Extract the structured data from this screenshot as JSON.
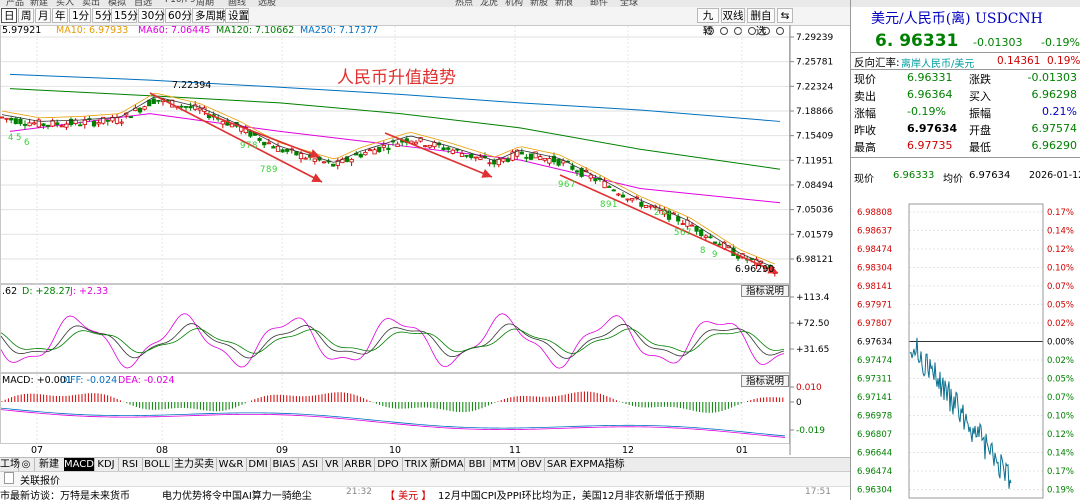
{
  "top_menu": [
    "产品",
    "新建",
    "买入",
    "卖出",
    "模拟",
    "自选",
    "F10/F9",
    "周期",
    "画线",
    "选股",
    "热点",
    "龙虎",
    "机构",
    "新股",
    "新浪",
    "邮件",
    "全球"
  ],
  "toolbar": {
    "periods": [
      "日",
      "周",
      "月",
      "年",
      "1分",
      "5分",
      "15分",
      "30分",
      "60分",
      "多周期",
      "设置"
    ],
    "active_period": "日",
    "right_buttons": [
      "九转",
      "双线",
      "删自选",
      "⇆"
    ]
  },
  "indicators": {
    "ma5": "5.97921",
    "ma10": "MA10: 6.97933",
    "ma60": "MA60: 7.06445",
    "ma120": "MA120: 7.10662",
    "ma250": "MA250: 7.17377",
    "kdj_k": ".62",
    "kdj_d": "D: +28.27",
    "kdj_j": "J: +2.33",
    "macd": "MACD: +0.001",
    "diff": "DIFF: -0.024",
    "dea": "DEA: -0.024"
  },
  "annotations": {
    "title": "人民币升值趋势",
    "high_label": "7.22394",
    "low_label": "6.96290",
    "sub_btn_1": "指标说明",
    "sub_btn_2": "指标说明",
    "td_counts": [
      "4",
      "5",
      "6",
      "7",
      "8",
      "9",
      "9",
      "7",
      "8",
      "9",
      "6",
      "7",
      "8",
      "9",
      "1",
      "2",
      "3",
      "4",
      "5",
      "6",
      "7",
      "8",
      "9"
    ]
  },
  "colors": {
    "ma5": "#000000",
    "ma10": "#e89c00",
    "ma60": "#e000e0",
    "ma120": "#008000",
    "ma250": "#0070c0",
    "up": "#d00000",
    "down": "#008000",
    "arrow": "#e03030",
    "td": "#32d232"
  },
  "chart_data": {
    "type": "line",
    "title": "人民币升值趋势",
    "x": [
      "07",
      "08",
      "09",
      "10",
      "11",
      "12",
      "01"
    ],
    "ylim": [
      6.9629,
      7.29239
    ],
    "y_ticks": [
      "7.29239",
      "7.25781",
      "7.22324",
      "7.18866",
      "7.15409",
      "7.11951",
      "7.08494",
      "7.05036",
      "7.01579",
      "6.98121"
    ],
    "series": [
      {
        "name": "MA60",
        "values": [
          7.16,
          7.185,
          7.16,
          7.14,
          7.12,
          7.08,
          7.06
        ]
      },
      {
        "name": "MA120",
        "values": [
          7.22,
          7.21,
          7.2,
          7.185,
          7.165,
          7.135,
          7.107
        ]
      },
      {
        "name": "MA250",
        "values": [
          7.24,
          7.232,
          7.222,
          7.212,
          7.2,
          7.19,
          7.174
        ]
      }
    ],
    "annotations": [
      {
        "label": "7.22394",
        "type": "high"
      },
      {
        "label": "6.96290",
        "type": "low"
      }
    ],
    "kdj_ticks": [
      "+113.4",
      "+72.50",
      "+31.65"
    ],
    "macd_ticks": [
      "0.010",
      "0",
      "-0.019"
    ]
  },
  "tabs": [
    "工场",
    "",
    "新建",
    "MACD",
    "KDJ",
    "RSI",
    "BOLL",
    "主力买卖",
    "W&R",
    "DMI",
    "BIAS",
    "ASI",
    "VR",
    "ARBR",
    "DPO",
    "TRIX",
    "新DMA",
    "BBI",
    "MTM",
    "OBV",
    "SAR",
    "EXPMA指标"
  ],
  "active_tab": "MACD",
  "news_bar_label": "关联报价",
  "ticker": {
    "left": "市最新访谈：万特是未来货币",
    "mid": "电力优势将令中国AI算力一骑绝尘",
    "time": "21:32",
    "tag": "【 美元 】",
    "right": "12月中国CPI及PPI环比均为正，美国12月非农新增低于预期",
    "time2": "17:51"
  },
  "quote": {
    "name": "美元/人民币(离) USDCNH",
    "price": "6. 96331",
    "change": "-0.01303",
    "pct": "-0.19%",
    "reverse_label": "反向汇率:",
    "reverse_name": "离岸人民币/美元",
    "reverse_value": "0.14361",
    "reverse_pct": "0.19%",
    "rows": [
      {
        "l1": "现价",
        "v1": "6.96331",
        "l2": "涨跌",
        "v2": "-0.01303"
      },
      {
        "l1": "卖出",
        "v1": "6.96364",
        "l2": "买入",
        "v2": "6.96298"
      },
      {
        "l1": "涨幅",
        "v1": "-0.19%",
        "l2": "振幅",
        "v2": "0.21%"
      },
      {
        "l1": "昨收",
        "v1": "6.97634",
        "l2": "开盘",
        "v2": "6.97574"
      },
      {
        "l1": "最高",
        "v1": "6.97735",
        "l2": "最低",
        "v2": "6.96290"
      }
    ],
    "intraday": {
      "now_label": "现价",
      "now": "6.96333",
      "avg_label": "均价",
      "avg": "6.97634",
      "date": "2026-01-12"
    },
    "mini_left": [
      "6.98808",
      "6.98637",
      "6.98474",
      "6.98304",
      "6.98141",
      "6.97971",
      "6.97807",
      "6.97634",
      "6.97474",
      "6.97311",
      "6.97141",
      "6.96978",
      "6.96807",
      "6.96644",
      "6.96474",
      "6.96304"
    ],
    "mini_right": [
      "0.17%",
      "0.14%",
      "0.12%",
      "0.10%",
      "0.07%",
      "0.05%",
      "0.02%",
      "0.00%",
      "0.02%",
      "0.05%",
      "0.07%",
      "0.10%",
      "0.12%",
      "0.14%",
      "0.17%",
      "0.19%"
    ]
  }
}
